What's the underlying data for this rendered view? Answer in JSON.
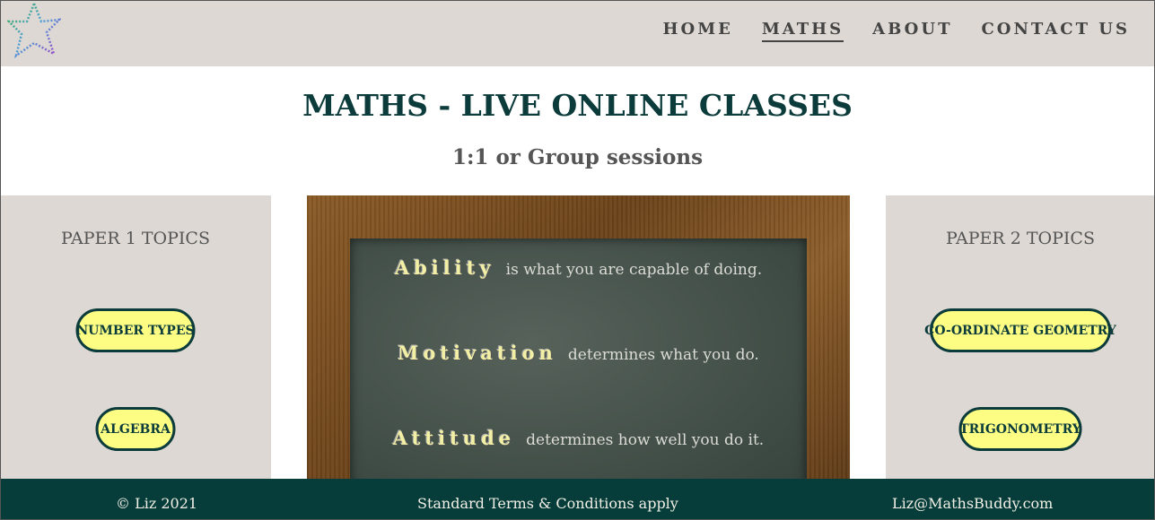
{
  "nav": {
    "items": [
      {
        "label": "HOME",
        "active": false
      },
      {
        "label": "MATHS",
        "active": true
      },
      {
        "label": "ABOUT",
        "active": false
      },
      {
        "label": "CONTACT US",
        "active": false
      }
    ]
  },
  "hero": {
    "title": "MATHS - LIVE ONLINE CLASSES",
    "subtitle": "1:1 or Group sessions"
  },
  "left_panel": {
    "heading": "PAPER 1 TOPICS",
    "topics": [
      "NUMBER TYPES",
      "ALGEBRA"
    ]
  },
  "right_panel": {
    "heading": "PAPER 2 TOPICS",
    "topics": [
      "CO-ORDINATE GEOMETRY",
      "TRIGONOMETRY"
    ]
  },
  "board": {
    "lines": [
      {
        "word": "Ability",
        "rest": "is what you are capable of doing."
      },
      {
        "word": "Motivation",
        "rest": "determines what you do."
      },
      {
        "word": "Attitude",
        "rest": "determines how well you do it."
      }
    ]
  },
  "footer": {
    "copyright": "© Liz 2021",
    "terms": "Standard Terms & Conditions apply",
    "email": "Liz@MathsBuddy.com"
  },
  "colors": {
    "header_bg": "#ddd8d3",
    "accent_dark": "#0b3b3a",
    "pill_bg": "#fdfd84",
    "footer_bg": "#063d3a"
  },
  "icons": {
    "logo": "star-logo-icon"
  }
}
